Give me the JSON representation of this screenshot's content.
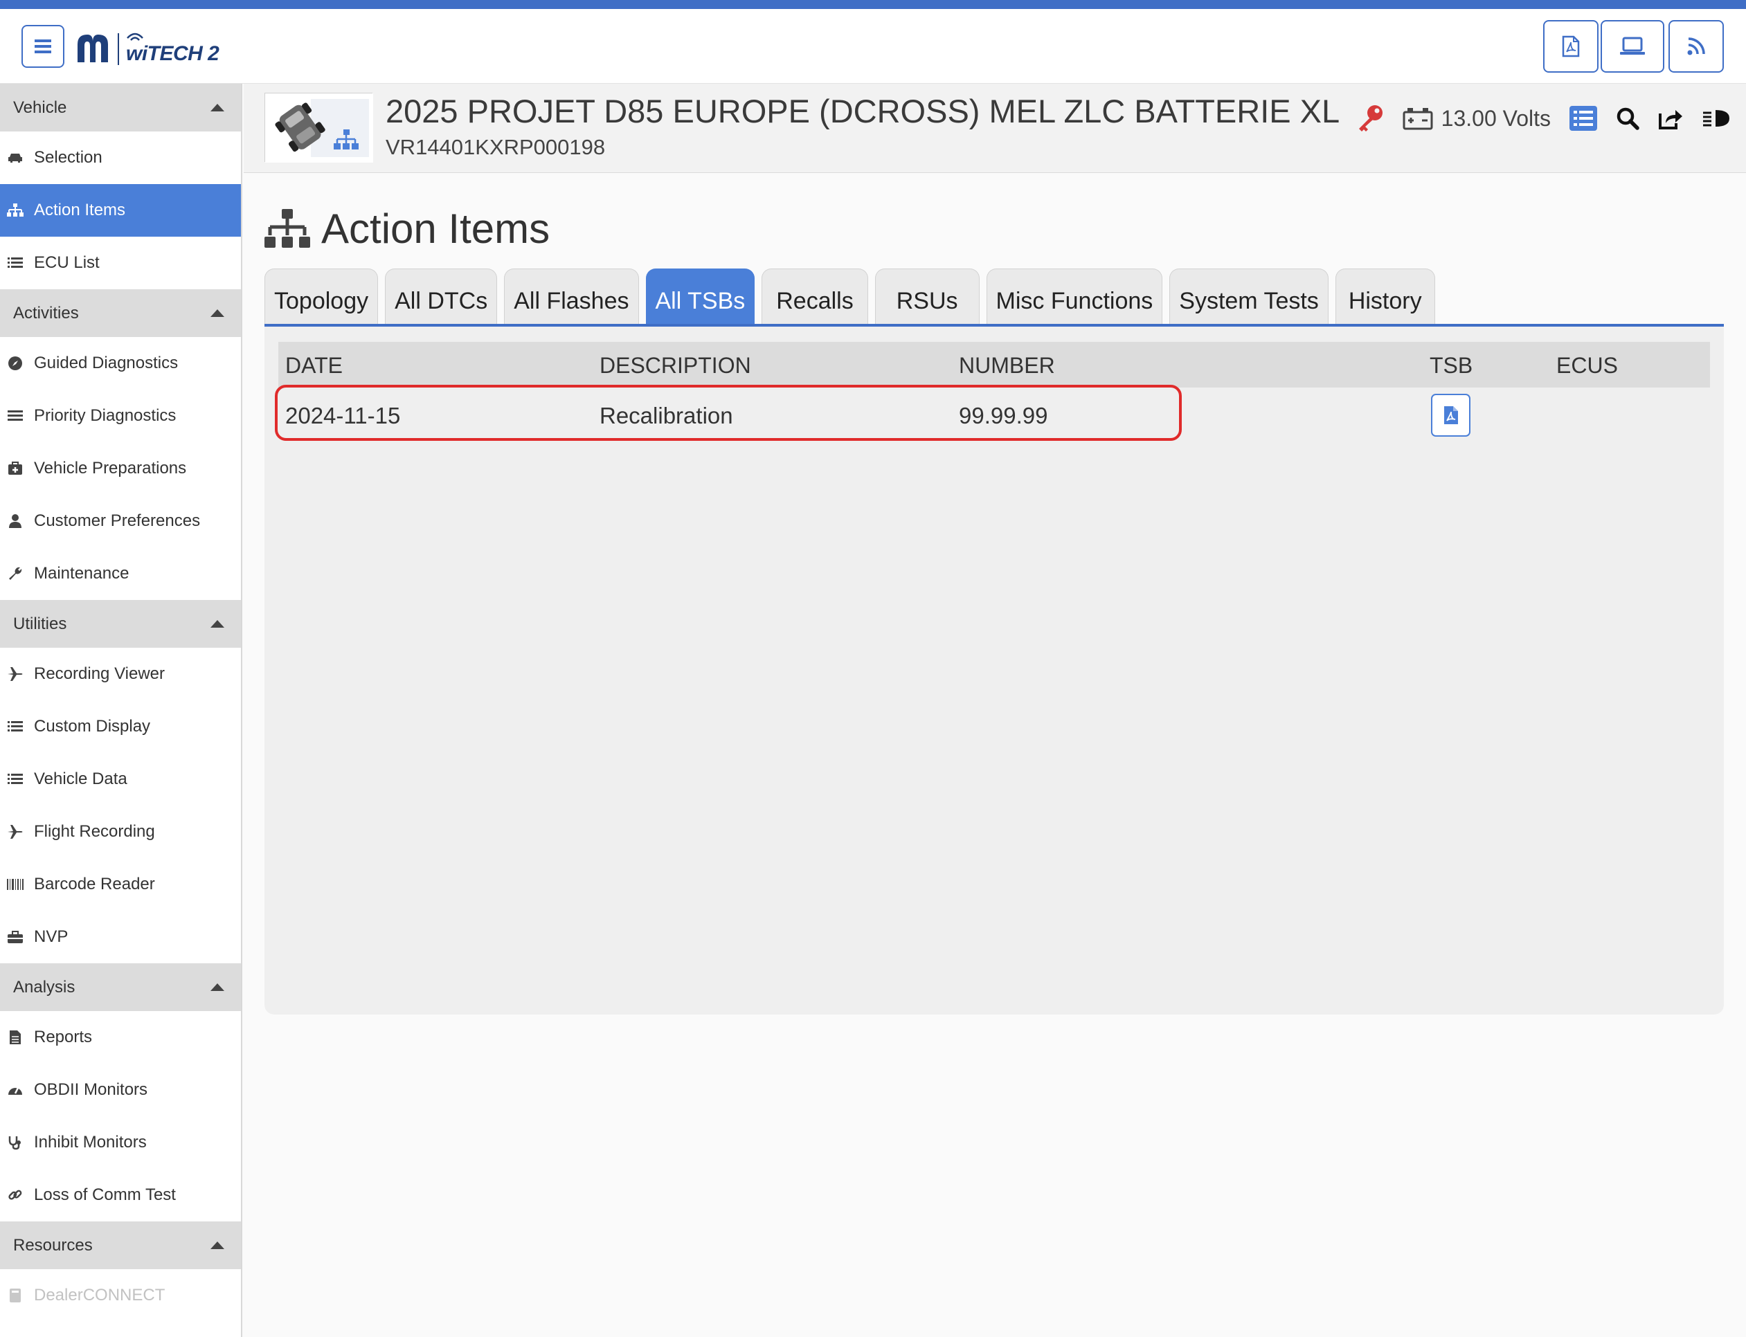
{
  "colors": {
    "accent": "#3f6ec6",
    "active_nav": "#4a7fd8",
    "highlight": "#e02b2b",
    "key": "#d63a3a"
  },
  "header": {
    "logo_text": "wiTECH 2",
    "brand_text": "MOPAR",
    "buttons": [
      "pdf-icon",
      "laptop-icon",
      "rss-icon"
    ]
  },
  "sidebar": {
    "sections": [
      {
        "title": "Vehicle",
        "items": [
          {
            "label": "Selection",
            "icon": "car-icon"
          },
          {
            "label": "Action Items",
            "icon": "sitemap-icon",
            "active": true
          },
          {
            "label": "ECU List",
            "icon": "list-icon"
          }
        ]
      },
      {
        "title": "Activities",
        "items": [
          {
            "label": "Guided Diagnostics",
            "icon": "compass-icon"
          },
          {
            "label": "Priority Diagnostics",
            "icon": "bars-icon"
          },
          {
            "label": "Vehicle Preparations",
            "icon": "medkit-icon"
          },
          {
            "label": "Customer Preferences",
            "icon": "user-icon"
          },
          {
            "label": "Maintenance",
            "icon": "wrench-icon"
          }
        ]
      },
      {
        "title": "Utilities",
        "items": [
          {
            "label": "Recording Viewer",
            "icon": "plane-icon"
          },
          {
            "label": "Custom Display",
            "icon": "list-icon"
          },
          {
            "label": "Vehicle Data",
            "icon": "list-icon"
          },
          {
            "label": "Flight Recording",
            "icon": "plane-icon"
          },
          {
            "label": "Barcode Reader",
            "icon": "barcode-icon"
          },
          {
            "label": "NVP",
            "icon": "toolbox-icon"
          }
        ]
      },
      {
        "title": "Analysis",
        "items": [
          {
            "label": "Reports",
            "icon": "file-icon"
          },
          {
            "label": "OBDII Monitors",
            "icon": "gauge-icon"
          },
          {
            "label": "Inhibit Monitors",
            "icon": "stethoscope-icon"
          },
          {
            "label": "Loss of Comm Test",
            "icon": "link-icon"
          }
        ]
      },
      {
        "title": "Resources",
        "items": [
          {
            "label": "DealerCONNECT",
            "icon": "book-icon",
            "disabled": true
          }
        ]
      }
    ]
  },
  "vehicle": {
    "title": "2025 PROJET D85 EUROPE (DCROSS) MEL ZLC BATTERIE XL",
    "vin": "VR14401KXRP000198",
    "voltage": "13.00 Volts"
  },
  "page": {
    "title": "Action Items",
    "tabs": [
      "Topology",
      "All DTCs",
      "All Flashes",
      "All TSBs",
      "Recalls",
      "RSUs",
      "Misc Functions",
      "System Tests",
      "History"
    ],
    "active_tab": "All TSBs"
  },
  "table": {
    "columns": [
      "DATE",
      "DESCRIPTION",
      "NUMBER",
      "TSB",
      "ECUS"
    ],
    "rows": [
      {
        "date": "2024-11-15",
        "description": "Recalibration",
        "number": "99.99.99",
        "tsb_icon": "pdf-icon",
        "ecus": ""
      }
    ]
  }
}
